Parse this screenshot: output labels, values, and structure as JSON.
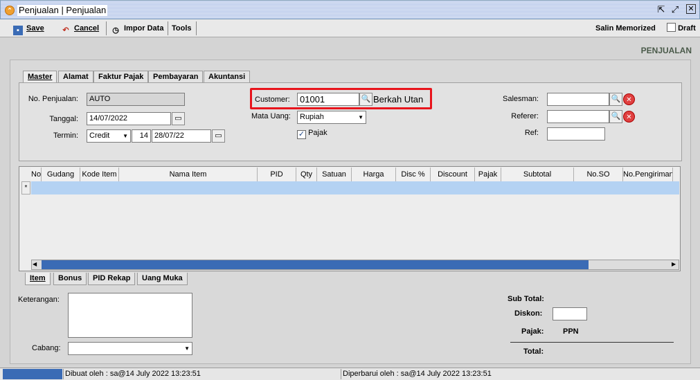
{
  "window": {
    "title": "Penjualan | Penjualan"
  },
  "toolbar": {
    "save_label": "Save",
    "cancel_label": "Cancel",
    "impor_label": "Impor Data",
    "tools_label": "Tools",
    "salin_label": "Salin Memorized",
    "draft_label": "Draft"
  },
  "page": {
    "heading": "PENJUALAN"
  },
  "tabs": [
    "Master",
    "Alamat",
    "Faktur Pajak",
    "Pembayaran",
    "Akuntansi"
  ],
  "master": {
    "no_penjualan_label": "No. Penjualan:",
    "no_penjualan_value": "AUTO",
    "tanggal_label": "Tanggal:",
    "tanggal_value": "14/07/2022",
    "termin_label": "Termin:",
    "termin_value": "Credit",
    "termin_days": "14",
    "termin_date": "28/07/22",
    "customer_label": "Customer:",
    "customer_code": "01001",
    "customer_name": "Berkah Utan",
    "mata_uang_label": "Mata Uang:",
    "mata_uang_value": "Rupiah",
    "pajak_label": "Pajak",
    "salesman_label": "Salesman:",
    "referer_label": "Referer:",
    "ref_label": "Ref:"
  },
  "grid": {
    "columns": [
      "No",
      "Gudang",
      "Kode Item",
      "Nama Item",
      "PID",
      "Qty",
      "Satuan",
      "Harga",
      "Disc %",
      "Discount",
      "Pajak",
      "Subtotal",
      "No.SO",
      "No.Pengiriman"
    ],
    "new_row_marker": "*"
  },
  "bottom_tabs": [
    "Item",
    "Bonus",
    "PID Rekap",
    "Uang Muka"
  ],
  "footer": {
    "keterangan_label": "Keterangan:",
    "cabang_label": "Cabang:",
    "subtotal_label": "Sub Total:",
    "diskon_label": "Diskon:",
    "pajak_label": "Pajak:",
    "pajak_value": "PPN",
    "total_label": "Total:"
  },
  "status": {
    "dibuat": "Dibuat oleh : sa@14 July 2022  13:23:51",
    "diperbarui": "Diperbarui oleh : sa@14 July 2022  13:23:51"
  },
  "colors": {
    "highlight": "#e8141c",
    "row_selected": "#b4d2f3",
    "scroll_thumb": "#3a6bb5"
  }
}
